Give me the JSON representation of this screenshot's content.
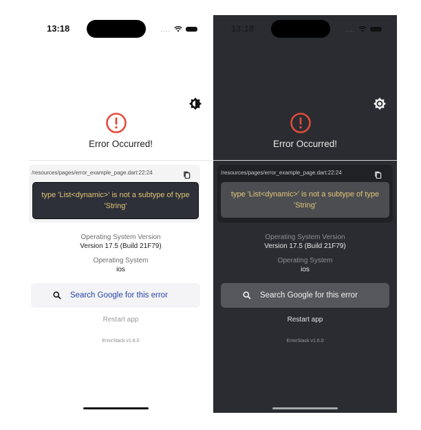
{
  "screens": [
    {
      "theme": "light",
      "status_time": "13:18",
      "title": "Error Occurred!",
      "file_path": "/resources/pages/error_example_page.dart:22:24",
      "error_message": "type 'List<dynamic>' is not a subtype of type 'String'",
      "os_version_label": "Operating System Version",
      "os_version_value": "Version 17.5 (Build 21F79)",
      "os_label": "Operating System",
      "os_value": "ios",
      "search_label": "Search Google for this error",
      "restart_label": "Restart app",
      "version_label": "ErrorStack v1.6.0"
    },
    {
      "theme": "dark",
      "status_time": "13:18",
      "title": "Error Occurred!",
      "file_path": "/resources/pages/error_example_page.dart:22:24",
      "error_message": "type 'List<dynamic>' is not a subtype of type 'String'",
      "os_version_label": "Operating System Version",
      "os_version_value": "Version 17.5 (Build 21F79)",
      "os_label": "Operating System",
      "os_value": "ios",
      "search_label": "Search Google for this error",
      "restart_label": "Restart app",
      "version_label": "ErrorStack v1.6.0"
    }
  ],
  "icons": {
    "theme_toggle_light": "brightness-half-icon",
    "theme_toggle_dark": "brightness-icon",
    "error": "error-circle-icon",
    "copy": "copy-icon",
    "search": "search-icon",
    "wifi": "wifi-icon",
    "battery": "battery-icon"
  },
  "colors": {
    "error_red": "#e14b3c",
    "error_text": "#e2c478",
    "light_link": "#2541a7",
    "dark_bg": "#2a2c31"
  }
}
